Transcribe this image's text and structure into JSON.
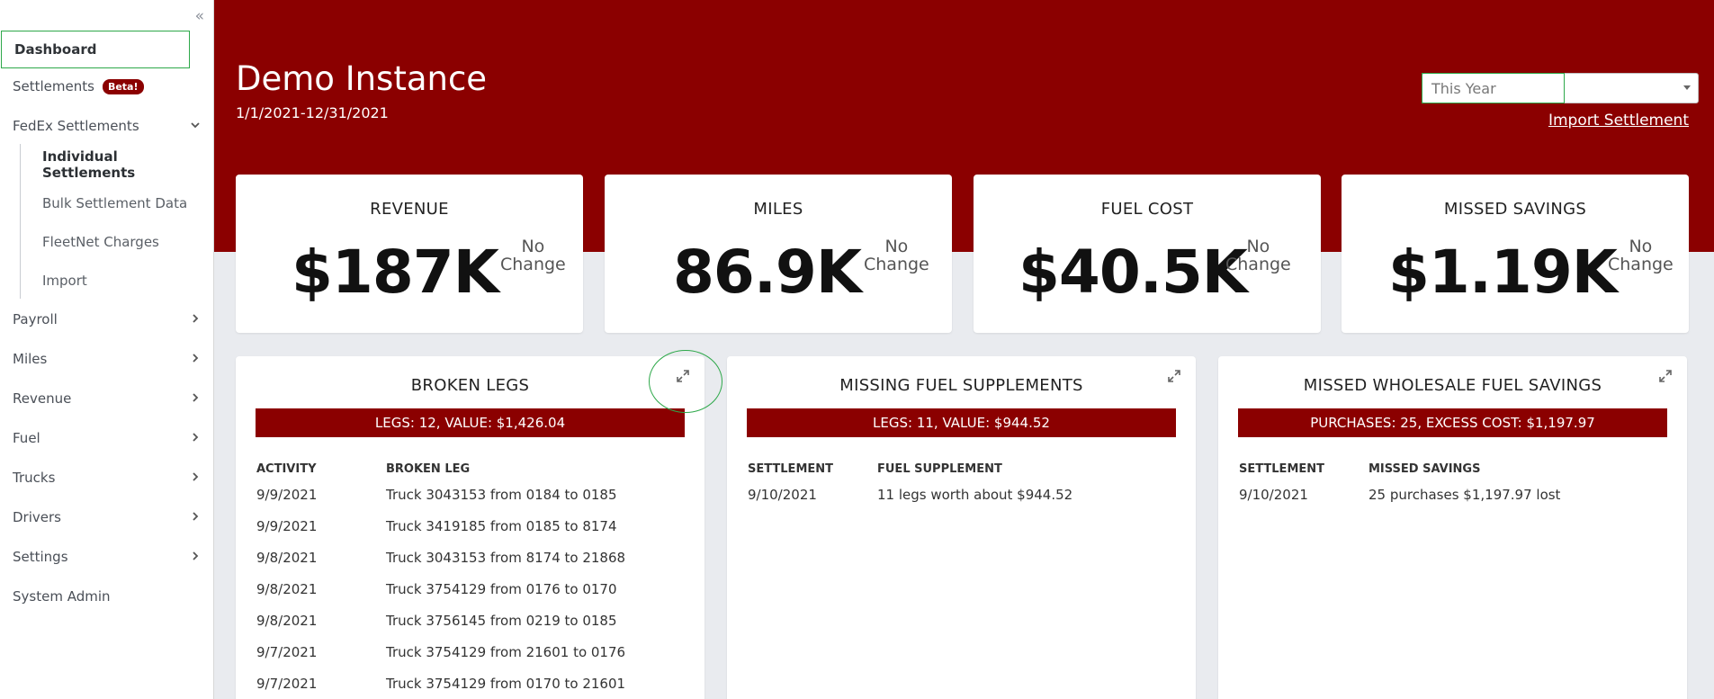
{
  "sidebar": {
    "collapse_glyph": "«",
    "items": [
      {
        "label": "Dashboard"
      },
      {
        "label": "Settlements",
        "badge": "Beta!"
      },
      {
        "label": "FedEx Settlements"
      },
      {
        "label": "Payroll"
      },
      {
        "label": "Miles"
      },
      {
        "label": "Revenue"
      },
      {
        "label": "Fuel"
      },
      {
        "label": "Trucks"
      },
      {
        "label": "Drivers"
      },
      {
        "label": "Settings"
      },
      {
        "label": "System Admin"
      }
    ],
    "subitems": [
      {
        "label": "Individual Settlements"
      },
      {
        "label": "Bulk Settlement Data"
      },
      {
        "label": "FleetNet Charges"
      },
      {
        "label": "Import"
      }
    ]
  },
  "header": {
    "title": "Demo Instance",
    "date_range": "1/1/2021-12/31/2021",
    "period_select": "This Year",
    "import_link": "Import Settlement"
  },
  "stats": [
    {
      "label": "REVENUE",
      "value": "$187K",
      "change_1": "No",
      "change_2": "Change"
    },
    {
      "label": "MILES",
      "value": "86.9K",
      "change_1": "No",
      "change_2": "Change"
    },
    {
      "label": "FUEL COST",
      "value": "$40.5K",
      "change_1": "No",
      "change_2": "Change"
    },
    {
      "label": "MISSED SAVINGS",
      "value": "$1.19K",
      "change_1": "No",
      "change_2": "Change"
    }
  ],
  "panels": {
    "broken_legs": {
      "title": "BROKEN LEGS",
      "summary": "LEGS: 12, VALUE: $1,426.04",
      "col1": "ACTIVITY",
      "col2": "BROKEN LEG",
      "rows": [
        {
          "date": "9/9/2021",
          "text": "Truck 3043153 from 0184 to 0185"
        },
        {
          "date": "9/9/2021",
          "text": "Truck 3419185 from 0185 to 8174"
        },
        {
          "date": "9/8/2021",
          "text": "Truck 3043153 from 8174 to 21868"
        },
        {
          "date": "9/8/2021",
          "text": "Truck 3754129 from 0176 to 0170"
        },
        {
          "date": "9/8/2021",
          "text": "Truck 3756145 from 0219 to 0185"
        },
        {
          "date": "9/7/2021",
          "text": "Truck 3754129 from 21601 to 0176"
        },
        {
          "date": "9/7/2021",
          "text": "Truck 3754129 from 0170 to 21601"
        }
      ]
    },
    "missing_fuel": {
      "title": "MISSING FUEL SUPPLEMENTS",
      "summary": "LEGS: 11, VALUE: $944.52",
      "col1": "SETTLEMENT",
      "col2": "FUEL SUPPLEMENT",
      "rows": [
        {
          "date": "9/10/2021",
          "text": "11 legs worth about $944.52"
        }
      ]
    },
    "missed_wholesale": {
      "title": "MISSED WHOLESALE FUEL SAVINGS",
      "summary": "PURCHASES: 25, EXCESS COST: $1,197.97",
      "col1": "SETTLEMENT",
      "col2": "MISSED SAVINGS",
      "rows": [
        {
          "date": "9/10/2021",
          "text": "25 purchases $1,197.97 lost"
        }
      ]
    }
  },
  "colors": {
    "brand": "#8b0000",
    "highlight": "#2ea84a",
    "background": "#e9ebef"
  }
}
